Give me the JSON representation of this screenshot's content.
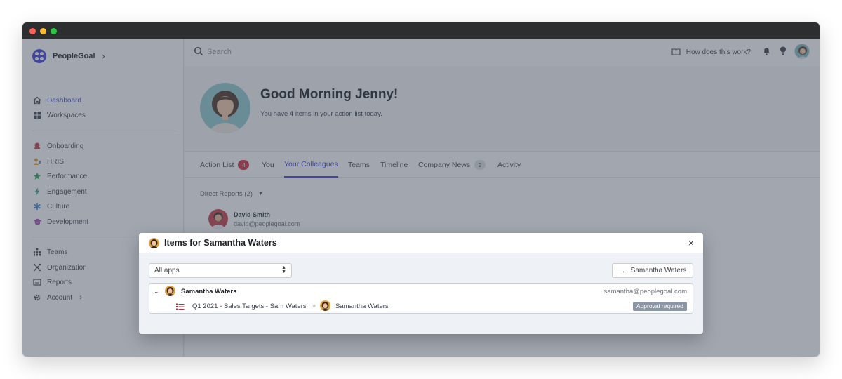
{
  "app": {
    "brand": "PeopleGoal"
  },
  "sidebar": {
    "items": [
      {
        "label": "Dashboard",
        "icon": "home-icon"
      },
      {
        "label": "Workspaces",
        "icon": "grid-icon"
      },
      {
        "label": "Onboarding",
        "icon": "onboarding-icon"
      },
      {
        "label": "HRIS",
        "icon": "hris-icon"
      },
      {
        "label": "Performance",
        "icon": "star-icon"
      },
      {
        "label": "Engagement",
        "icon": "bolt-icon"
      },
      {
        "label": "Culture",
        "icon": "asterisk-icon"
      },
      {
        "label": "Development",
        "icon": "graduation-cap-icon"
      },
      {
        "label": "Teams",
        "icon": "teams-icon"
      },
      {
        "label": "Organization",
        "icon": "organization-icon"
      },
      {
        "label": "Reports",
        "icon": "reports-icon"
      },
      {
        "label": "Account",
        "icon": "gear-icon"
      }
    ]
  },
  "topbar": {
    "search_placeholder": "Search",
    "help_label": "How does this work?"
  },
  "hero": {
    "greeting": "Good Morning Jenny!",
    "sub_prefix": "You have ",
    "count": "4",
    "sub_suffix": " items in your action list today."
  },
  "tabs": [
    {
      "label": "Action List",
      "badge": "4"
    },
    {
      "label": "You"
    },
    {
      "label": "Your Colleagues"
    },
    {
      "label": "Teams"
    },
    {
      "label": "Timeline"
    },
    {
      "label": "Company News",
      "badge": "2"
    },
    {
      "label": "Activity"
    }
  ],
  "direct_reports": {
    "header": "Direct Reports (2)",
    "people": [
      {
        "name": "David Smith",
        "email": "david@peoplegoal.com"
      }
    ]
  },
  "modal": {
    "title": "Items for Samantha Waters",
    "close": "×",
    "filter_value": "All apps",
    "go_button": "Samantha Waters",
    "row": {
      "name": "Samantha Waters",
      "email": "samantha@peoplegoal.com",
      "item_title": "Q1 2021 - Sales Targets - Sam Waters",
      "separator": "»",
      "owner": "Samantha Waters",
      "status": "Approval required"
    }
  },
  "colors": {
    "accent": "#3b3fd8",
    "badge_red": "#d0283a",
    "status_grey": "#8b96a5"
  }
}
